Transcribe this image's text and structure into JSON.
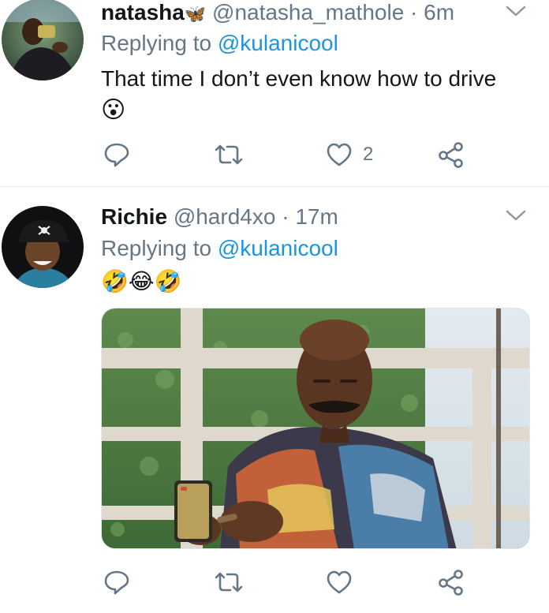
{
  "tweets": [
    {
      "display_name": "natasha",
      "name_emoji": "🦋",
      "handle": "@natasha_mathole",
      "separator": "·",
      "time": "6m",
      "replying_prefix": "Replying to",
      "replying_to": "@kulanicool",
      "text": "That time I don’t even know how to drive",
      "emoji_line": "😮",
      "actions": {
        "reply_count": "",
        "retweet_count": "",
        "like_count": "2",
        "share": ""
      }
    },
    {
      "display_name": "Richie",
      "handle": "@hard4xo",
      "separator": "·",
      "time": "17m",
      "replying_prefix": "Replying to",
      "replying_to": "@kulanicool",
      "emoji_line": "🤣😂🤣",
      "actions": {
        "reply_count": "",
        "retweet_count": "",
        "like_count": "",
        "share": ""
      }
    }
  ],
  "colors": {
    "text": "#14171a",
    "secondary": "#657786",
    "link": "#1b95e0",
    "divider": "#e6ecf0"
  },
  "icons": {
    "reply": "reply-icon",
    "retweet": "retweet-icon",
    "like": "heart-icon",
    "share": "share-icon",
    "more": "chevron-down-icon"
  }
}
